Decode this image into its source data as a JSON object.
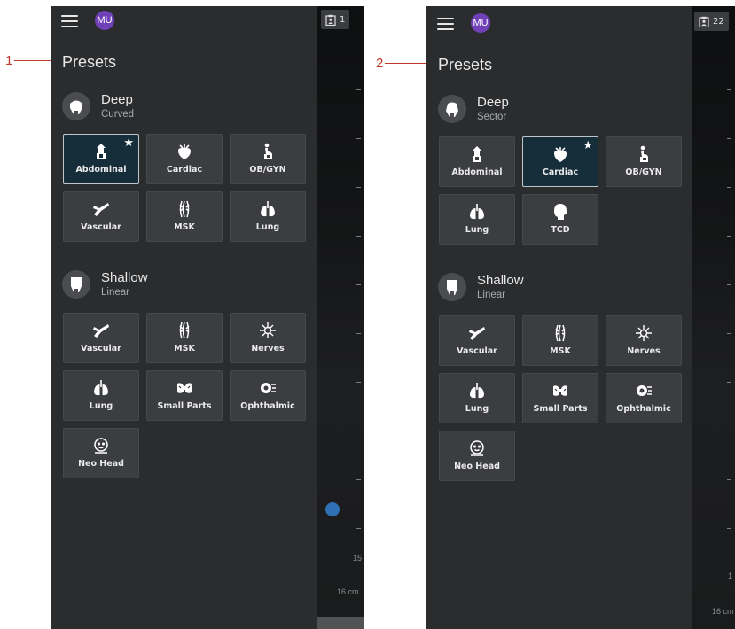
{
  "screens": [
    {
      "callout": "1",
      "menu_icon": "hamburger-menu-icon",
      "avatar_initials": "MU",
      "patient_count": "1",
      "title": "Presets",
      "depth_labels": [
        "15",
        "16 cm"
      ],
      "groups": [
        {
          "name": "Deep",
          "type": "Curved",
          "presets": [
            {
              "label": "Abdominal",
              "icon": "abdominal-icon",
              "selected": true
            },
            {
              "label": "Cardiac",
              "icon": "cardiac-icon"
            },
            {
              "label": "OB/GYN",
              "icon": "obgyn-icon"
            },
            {
              "label": "Vascular",
              "icon": "vascular-icon"
            },
            {
              "label": "MSK",
              "icon": "msk-icon"
            },
            {
              "label": "Lung",
              "icon": "lung-icon"
            }
          ]
        },
        {
          "name": "Shallow",
          "type": "Linear",
          "presets": [
            {
              "label": "Vascular",
              "icon": "vascular-icon"
            },
            {
              "label": "MSK",
              "icon": "msk-icon"
            },
            {
              "label": "Nerves",
              "icon": "nerves-icon"
            },
            {
              "label": "Lung",
              "icon": "lung-icon"
            },
            {
              "label": "Small Parts",
              "icon": "small-parts-icon"
            },
            {
              "label": "Ophthalmic",
              "icon": "ophthalmic-icon"
            },
            {
              "label": "Neo Head",
              "icon": "neo-head-icon"
            }
          ]
        }
      ]
    },
    {
      "callout": "2",
      "menu_icon": "hamburger-menu-icon",
      "avatar_initials": "MU",
      "patient_count": "22",
      "title": "Presets",
      "depth_labels": [
        "1",
        "16 cm"
      ],
      "groups": [
        {
          "name": "Deep",
          "type": "Sector",
          "presets": [
            {
              "label": "Abdominal",
              "icon": "abdominal-icon"
            },
            {
              "label": "Cardiac",
              "icon": "cardiac-icon",
              "selected": true
            },
            {
              "label": "OB/GYN",
              "icon": "obgyn-icon"
            },
            {
              "label": "Lung",
              "icon": "lung-icon"
            },
            {
              "label": "TCD",
              "icon": "tcd-icon"
            }
          ]
        },
        {
          "name": "Shallow",
          "type": "Linear",
          "presets": [
            {
              "label": "Vascular",
              "icon": "vascular-icon"
            },
            {
              "label": "MSK",
              "icon": "msk-icon"
            },
            {
              "label": "Nerves",
              "icon": "nerves-icon"
            },
            {
              "label": "Lung",
              "icon": "lung-icon"
            },
            {
              "label": "Small Parts",
              "icon": "small-parts-icon"
            },
            {
              "label": "Ophthalmic",
              "icon": "ophthalmic-icon"
            },
            {
              "label": "Neo Head",
              "icon": "neo-head-icon"
            }
          ]
        }
      ]
    }
  ],
  "colors": {
    "panel_bg": "#2b2c2e",
    "tile_bg": "#3b3d40",
    "tile_selected_bg": "#162d3a",
    "avatar_bg": "#6f40b8",
    "callout": "#c0392b",
    "dot": "#2f6fb3"
  }
}
